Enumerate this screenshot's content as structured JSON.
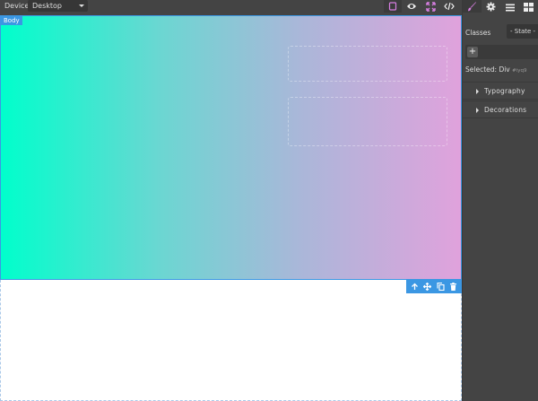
{
  "topbar": {
    "device_label": "Device",
    "device_value": "Desktop",
    "buttons": [
      {
        "icon": "square-outline-icon",
        "active": true
      },
      {
        "icon": "eye-icon",
        "active": false
      },
      {
        "icon": "fullscreen-icon",
        "active": false
      },
      {
        "icon": "code-icon",
        "active": false
      }
    ]
  },
  "canvas": {
    "body_badge": "Body",
    "hero_gradient": [
      "#00ffcc",
      "#e0a2dc"
    ],
    "selection_color": "#3b97e3",
    "toolbar_icons": [
      "arrow-up-icon",
      "move-icon",
      "clone-icon",
      "delete-icon"
    ]
  },
  "panel": {
    "tabs": [
      "paint-brush-icon",
      "gear-icon",
      "menu-icon",
      "blocks-icon"
    ],
    "classes_label": "Classes",
    "state_value": "- State -",
    "add_class_label": "+",
    "selected_label": "Selected:",
    "selected_element": "Div",
    "selected_id": "#iyq9",
    "sectors": [
      "Typography",
      "Decorations"
    ]
  }
}
